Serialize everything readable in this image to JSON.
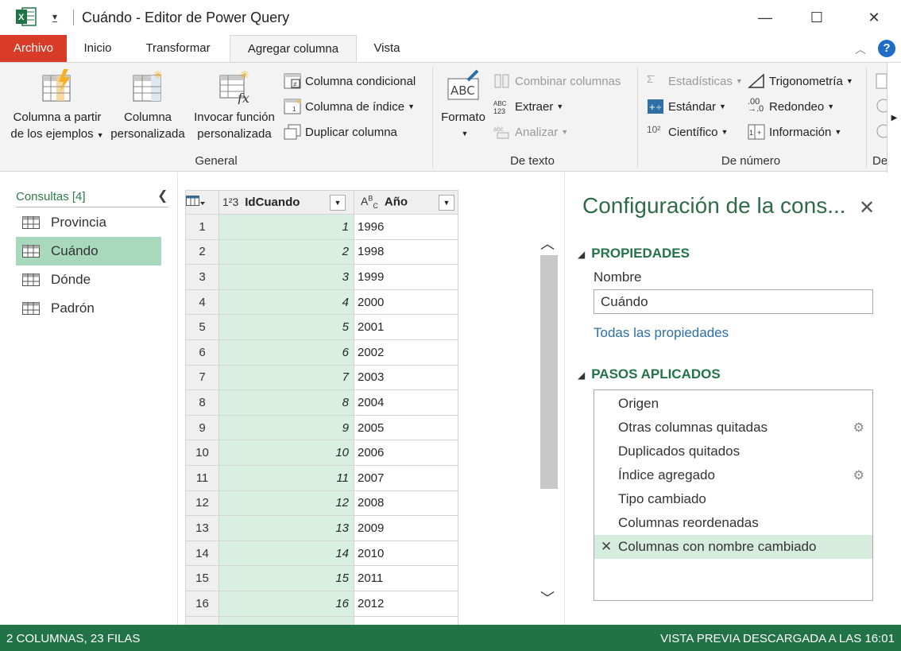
{
  "window": {
    "title": "Cuándo - Editor de Power Query",
    "minimize": "—",
    "maximize": "☐",
    "close": "✕"
  },
  "tabs": [
    {
      "label": "Archivo"
    },
    {
      "label": "Inicio"
    },
    {
      "label": "Transformar"
    },
    {
      "label": "Agregar columna"
    },
    {
      "label": "Vista"
    }
  ],
  "ribbon": {
    "general": {
      "label": "General",
      "col_examples_1": "Columna a partir",
      "col_examples_2": "de los ejemplos",
      "col_custom_1": "Columna",
      "col_custom_2": "personalizada",
      "invoke_1": "Invocar función",
      "invoke_2": "personalizada",
      "conditional": "Columna condicional",
      "index": "Columna de índice",
      "duplicate": "Duplicar columna"
    },
    "text": {
      "label": "De texto",
      "format": "Formato",
      "combine": "Combinar columnas",
      "extract": "Extraer",
      "parse": "Analizar"
    },
    "number": {
      "label": "De número",
      "statistics": "Estadísticas",
      "standard": "Estándar",
      "scientific": "Científico",
      "trig": "Trigonometría",
      "rounding": "Redondeo",
      "info": "Información"
    },
    "cut_label": "De"
  },
  "queries": {
    "header": "Consultas [4]",
    "items": [
      {
        "label": "Provincia"
      },
      {
        "label": "Cuándo"
      },
      {
        "label": "Dónde"
      },
      {
        "label": "Padrón"
      }
    ]
  },
  "grid": {
    "columns": [
      {
        "type": "1²3",
        "name": "IdCuando"
      },
      {
        "type": "A^B_C",
        "name": "Año"
      }
    ],
    "rows": [
      {
        "n": "1",
        "id": "1",
        "year": "1996"
      },
      {
        "n": "2",
        "id": "2",
        "year": "1998"
      },
      {
        "n": "3",
        "id": "3",
        "year": "1999"
      },
      {
        "n": "4",
        "id": "4",
        "year": "2000"
      },
      {
        "n": "5",
        "id": "5",
        "year": "2001"
      },
      {
        "n": "6",
        "id": "6",
        "year": "2002"
      },
      {
        "n": "7",
        "id": "7",
        "year": "2003"
      },
      {
        "n": "8",
        "id": "8",
        "year": "2004"
      },
      {
        "n": "9",
        "id": "9",
        "year": "2005"
      },
      {
        "n": "10",
        "id": "10",
        "year": "2006"
      },
      {
        "n": "11",
        "id": "11",
        "year": "2007"
      },
      {
        "n": "12",
        "id": "12",
        "year": "2008"
      },
      {
        "n": "13",
        "id": "13",
        "year": "2009"
      },
      {
        "n": "14",
        "id": "14",
        "year": "2010"
      },
      {
        "n": "15",
        "id": "15",
        "year": "2011"
      },
      {
        "n": "16",
        "id": "16",
        "year": "2012"
      }
    ]
  },
  "settings": {
    "title": "Configuración de la cons...",
    "properties_header": "PROPIEDADES",
    "name_label": "Nombre",
    "name_value": "Cuándo",
    "all_properties": "Todas las propiedades",
    "steps_header": "PASOS APLICADOS",
    "steps": [
      {
        "label": "Origen",
        "gear": false
      },
      {
        "label": "Otras columnas quitadas",
        "gear": true
      },
      {
        "label": "Duplicados quitados",
        "gear": false
      },
      {
        "label": "Índice agregado",
        "gear": true
      },
      {
        "label": "Tipo cambiado",
        "gear": false
      },
      {
        "label": "Columnas reordenadas",
        "gear": false
      },
      {
        "label": "Columnas con nombre cambiado",
        "gear": false,
        "selected": true
      }
    ]
  },
  "status": {
    "left": "2 COLUMNAS, 23 FILAS",
    "right": "VISTA PREVIA DESCARGADA A LAS 16:01"
  },
  "colors": {
    "accent_green": "#217346",
    "file_tab": "#d83b28",
    "selection": "#a8d9bd"
  }
}
